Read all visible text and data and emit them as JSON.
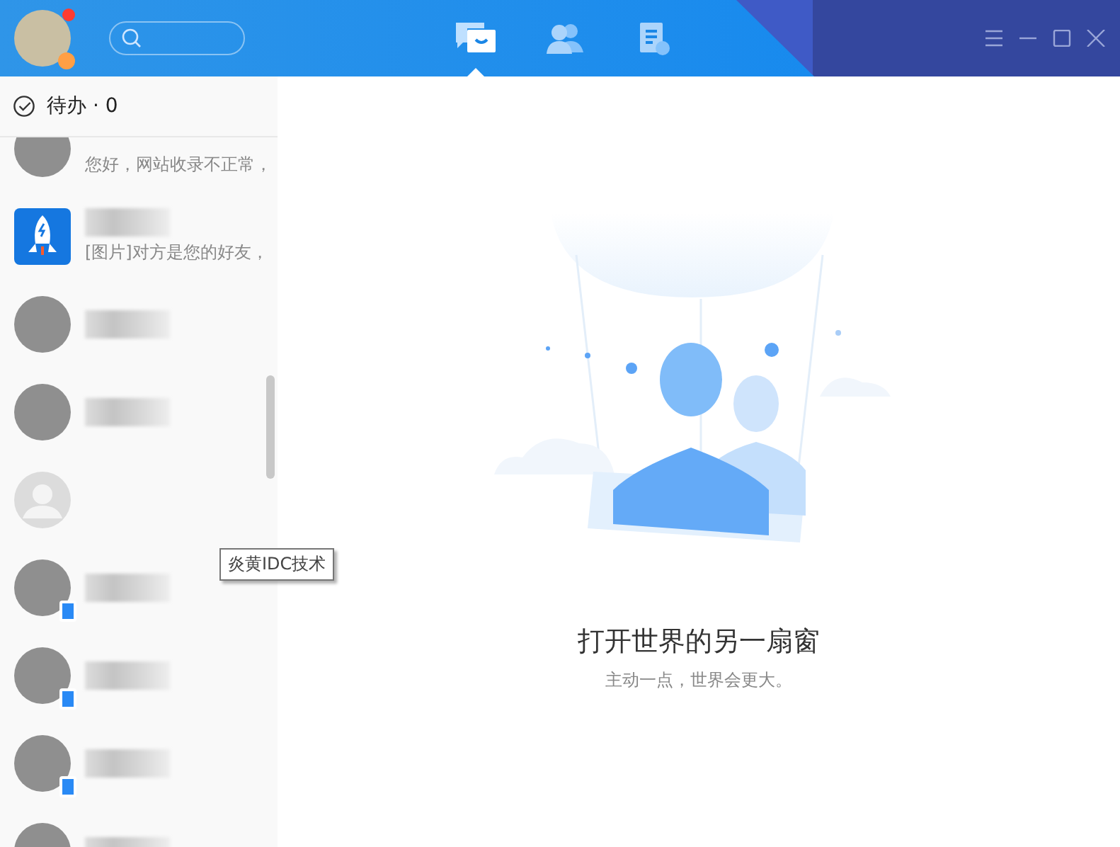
{
  "header": {
    "nav": [
      {
        "kind": "chat",
        "selected": true
      },
      {
        "kind": "contacts",
        "selected": false
      },
      {
        "kind": "apps",
        "selected": false
      }
    ]
  },
  "todo": {
    "label": "待办 · 0"
  },
  "conversations": [
    {
      "kind": "photo",
      "blurred_name": false,
      "preview": "您好，网站收录不正常，",
      "mobile": false
    },
    {
      "kind": "rocket",
      "blurred_name": true,
      "preview": "[图片]对方是您的好友，",
      "mobile": false
    },
    {
      "kind": "photo",
      "blurred_name": true,
      "mobile": false
    },
    {
      "kind": "photo",
      "blurred_name": true,
      "mobile": false
    },
    {
      "kind": "default",
      "blurred_name": false,
      "mobile": false
    },
    {
      "kind": "photo",
      "blurred_name": true,
      "mobile": true
    },
    {
      "kind": "photo",
      "blurred_name": true,
      "mobile": true
    },
    {
      "kind": "photo",
      "blurred_name": true,
      "mobile": true
    },
    {
      "kind": "photo",
      "blurred_name": true,
      "mobile": false
    }
  ],
  "tooltip": "炎黄IDC技术",
  "empty_state": {
    "title": "打开世界的另一扇窗",
    "subtitle": "主动一点，世界会更大。"
  }
}
